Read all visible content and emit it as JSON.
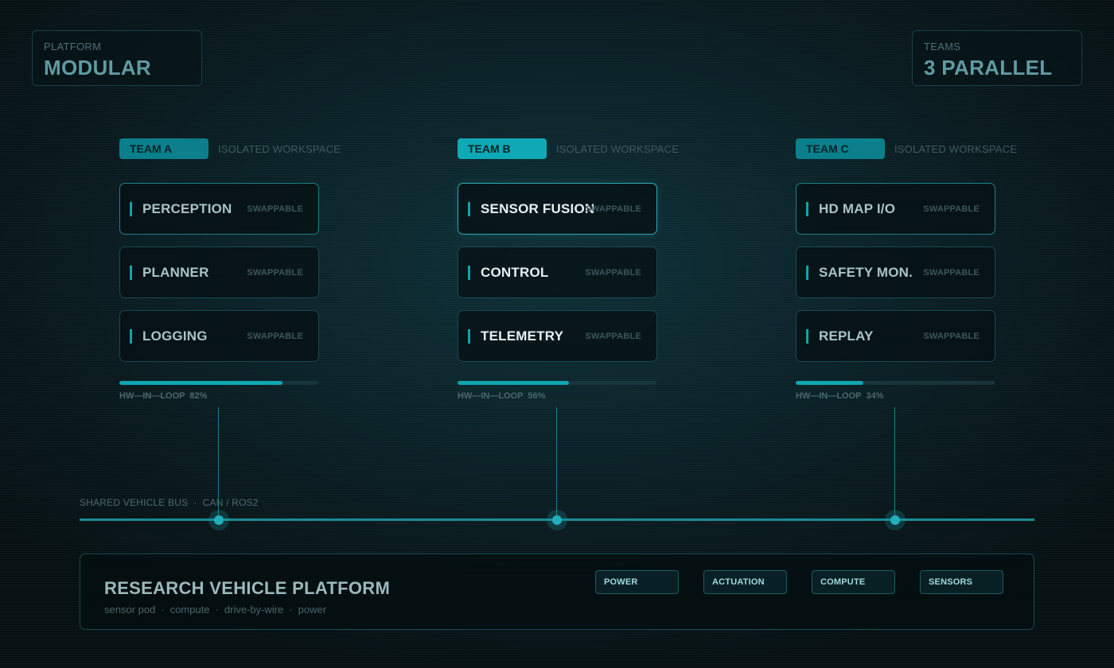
{
  "header": {
    "platform": {
      "label": "PLATFORM",
      "value": "MODULAR"
    },
    "teams": {
      "label": "TEAMS",
      "value": "3 PARALLEL"
    }
  },
  "teams": [
    {
      "tag": "TEAM A",
      "subtitle": "ISOLATED WORKSPACE",
      "modules": [
        {
          "name": "PERCEPTION",
          "status": "SWAPPABLE"
        },
        {
          "name": "PLANNER",
          "status": "SWAPPABLE"
        },
        {
          "name": "LOGGING",
          "status": "SWAPPABLE"
        }
      ],
      "progress_label": "HW—IN—LOOP  82%",
      "progress": 82
    },
    {
      "tag": "TEAM B",
      "subtitle": "ISOLATED WORKSPACE",
      "modules": [
        {
          "name": "SENSOR FUSION",
          "status": "SWAPPABLE"
        },
        {
          "name": "CONTROL",
          "status": "SWAPPABLE"
        },
        {
          "name": "TELEMETRY",
          "status": "SWAPPABLE"
        }
      ],
      "progress_label": "HW—IN—LOOP  56%",
      "progress": 56
    },
    {
      "tag": "TEAM C",
      "subtitle": "ISOLATED WORKSPACE",
      "modules": [
        {
          "name": "HD MAP I/O",
          "status": "SWAPPABLE"
        },
        {
          "name": "SAFETY MON.",
          "status": "SWAPPABLE"
        },
        {
          "name": "REPLAY",
          "status": "SWAPPABLE"
        }
      ],
      "progress_label": "HW—IN—LOOP  34%",
      "progress": 34
    }
  ],
  "bus": {
    "label": "SHARED VEHICLE BUS",
    "protocol": "CAN / ROS2"
  },
  "platform": {
    "title": "RESEARCH VEHICLE PLATFORM",
    "components": [
      "sensor pod",
      "compute",
      "drive-by-wire",
      "power"
    ],
    "chips": [
      "POWER",
      "ACTUATION",
      "COMPUTE",
      "SENSORS"
    ]
  },
  "colors": {
    "accent": "#0fa6b1",
    "accent_dark": "#0b7f8c",
    "background": "#0b242a"
  }
}
